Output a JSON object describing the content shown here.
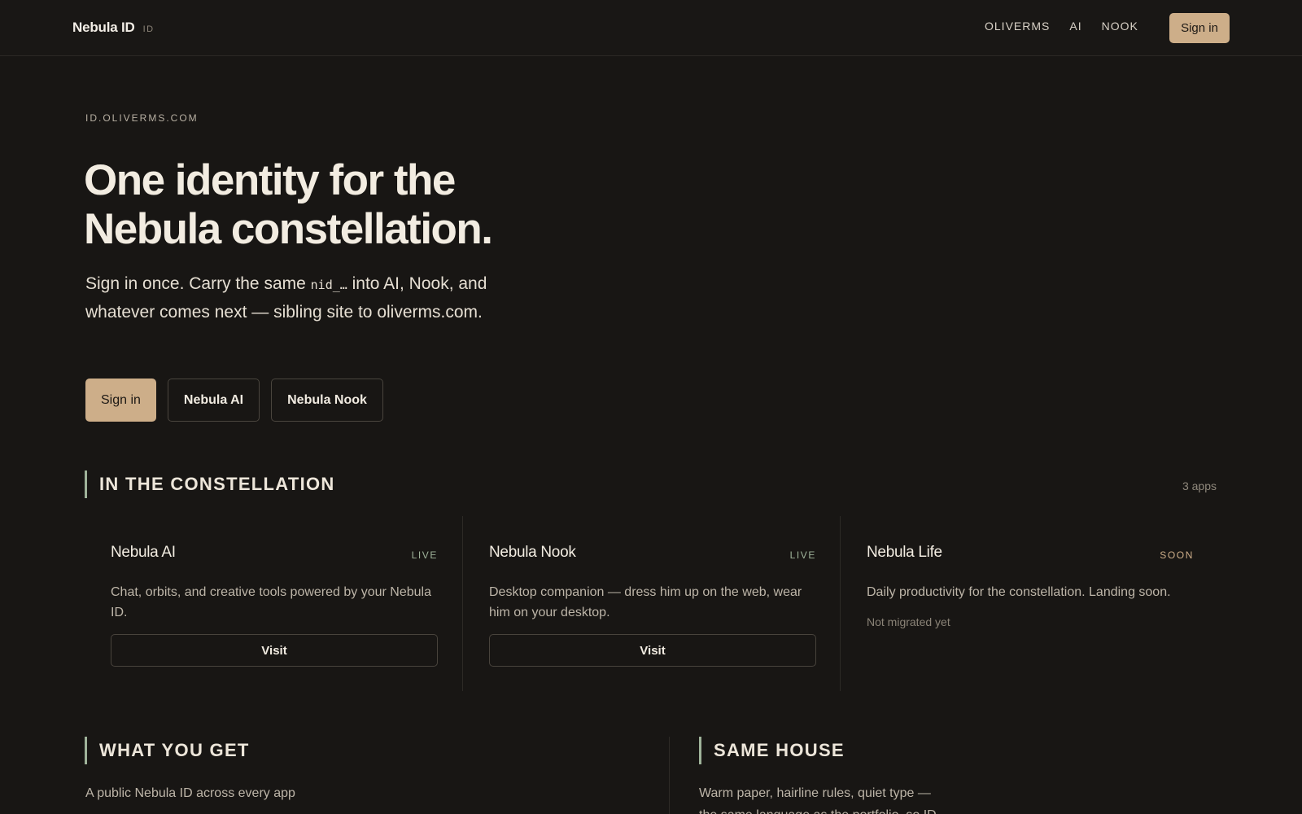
{
  "header": {
    "brand_name": "Nebula ID",
    "brand_tag": "ID",
    "nav": [
      "OLIVERMS",
      "AI",
      "NOOK"
    ],
    "signin_label": "Sign in"
  },
  "hero": {
    "eyebrow": "ID.OLIVERMS.COM",
    "title_line1": "One identity for the",
    "title_line2": "Nebula constellation.",
    "sub_before": "Sign in once. Carry the same ",
    "sub_code": "nid_…",
    "sub_after": " into AI, Nook, and whatever comes next — sibling site to oliverms.com.",
    "actions": {
      "signin": "Sign in",
      "ai": "Nebula AI",
      "nook": "Nebula Nook"
    }
  },
  "constellation": {
    "heading": "IN THE CONSTELLATION",
    "count": "3 apps",
    "apps": [
      {
        "name": "Nebula AI",
        "status": "LIVE",
        "desc": "Chat, orbits, and creative tools powered by your Nebula ID.",
        "action": "Visit"
      },
      {
        "name": "Nebula Nook",
        "status": "LIVE",
        "desc": "Desktop companion — dress him up on the web, wear him on your desktop.",
        "action": "Visit"
      },
      {
        "name": "Nebula Life",
        "status": "SOON",
        "desc": "Daily productivity for the constellation. Landing soon.",
        "note": "Not migrated yet"
      }
    ]
  },
  "what_you_get": {
    "heading": "WHAT YOU GET",
    "first_item": "A public Nebula ID across every app"
  },
  "same_house": {
    "heading": "SAME HOUSE",
    "text": "Warm paper, hairline rules, quiet type — the same language as the portfolio, so ID"
  },
  "colors": {
    "background": "#181614",
    "accent": "#cdae89",
    "live": "#9fb39a"
  }
}
